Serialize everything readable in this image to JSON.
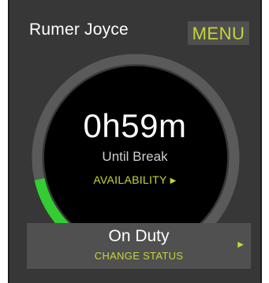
{
  "driver": {
    "name": "Rumer Joyce"
  },
  "menu": {
    "label": "MENU"
  },
  "timer": {
    "remaining": "0h59m",
    "caption": "Until Break",
    "elapsed_fraction": 0.12
  },
  "availability": {
    "label": "AVAILABILITY",
    "arrow_icon": "triangle-right-icon"
  },
  "status": {
    "current": "On Duty",
    "action_label": "CHANGE STATUS",
    "arrow_icon": "triangle-right-icon"
  },
  "colors": {
    "accent": "#c8d43a",
    "progress": "#33cc33",
    "track": "#5a5a5a",
    "background": "#373737",
    "gauge_face": "#000000"
  }
}
